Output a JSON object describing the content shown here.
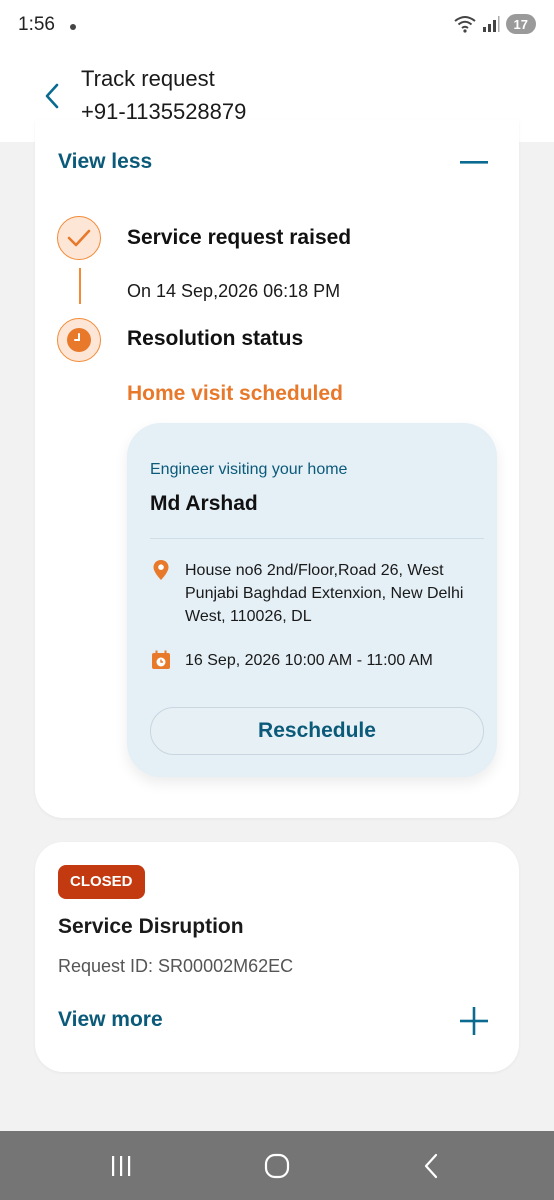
{
  "status_bar": {
    "time": "1:56",
    "battery": "17"
  },
  "header": {
    "title": "Track request",
    "subtitle": "+91-1135528879"
  },
  "request_card": {
    "toggle_label": "View less",
    "steps": [
      {
        "title": "Service request raised",
        "detail": "On 14 Sep,2026 06:18 PM"
      },
      {
        "title": "Resolution status",
        "detail": "Home visit scheduled"
      }
    ],
    "engineer": {
      "label": "Engineer visiting your home",
      "name": "Md Arshad",
      "address": "House no6 2nd/Floor,Road 26, West Punjabi Baghdad Extenxion, New Delhi West, 110026, DL",
      "slot": "16 Sep, 2026 10:00 AM - 11:00 AM",
      "reschedule_label": "Reschedule"
    }
  },
  "closed_card": {
    "badge": "CLOSED",
    "title": "Service Disruption",
    "request_id": "Request ID: SR00002M62EC",
    "toggle_label": "View more"
  },
  "colors": {
    "accent": "#0b5a7a",
    "orange": "#e8782a",
    "badge": "#c43a10",
    "box_bg": "#e4eff6"
  }
}
